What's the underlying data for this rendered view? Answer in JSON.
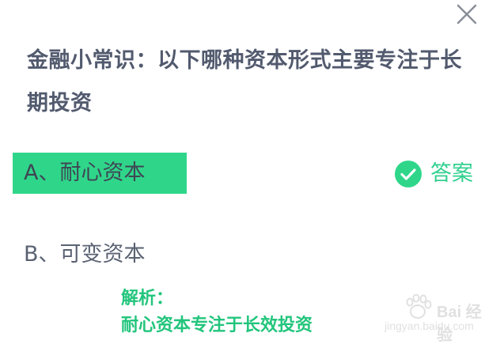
{
  "question": {
    "text": "金融小常识：以下哪种资本形式主要专注于长期投资"
  },
  "options": [
    {
      "label": "A、耐心资本",
      "correct": true
    },
    {
      "label": "B、可变资本",
      "correct": false
    }
  ],
  "answer": {
    "label": "答案",
    "icon": "check-circle-icon"
  },
  "analysis": {
    "title": "解析：",
    "text": "耐心资本专注于长效投资"
  },
  "watermark": {
    "brand": "Bai 经验",
    "url": "jingyan.baidu.com"
  },
  "colors": {
    "accent_green": "#2fd68a",
    "analysis_green": "#22c57c",
    "text_dark": "#525a6e"
  },
  "icons": {
    "close": "close-icon",
    "check": "check-circle-icon",
    "watermark_logo": "paw-logo"
  }
}
